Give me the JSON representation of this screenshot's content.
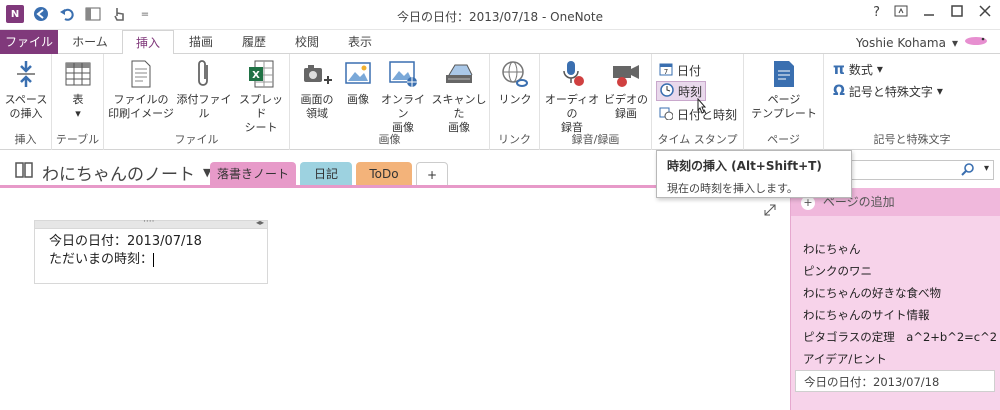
{
  "window": {
    "title": "今日の日付：2013/07/18 - OneNote",
    "help": "?",
    "qat_more": "="
  },
  "tabs": {
    "file": "ファイル",
    "items": [
      "ホーム",
      "挿入",
      "描画",
      "履歴",
      "校閲",
      "表示"
    ]
  },
  "user": {
    "name": "Yoshie Kohama"
  },
  "ribbon": {
    "space": [
      "スペース",
      "の挿入"
    ],
    "table": [
      "表"
    ],
    "printout": [
      "ファイルの",
      "印刷イメージ"
    ],
    "attach": [
      "添付ファイル"
    ],
    "spreadsheet": [
      "スプレッド",
      "シート"
    ],
    "screen": [
      "画面の",
      "領域"
    ],
    "picture": [
      "画像"
    ],
    "online": [
      "オンライン",
      "画像"
    ],
    "scanned": [
      "スキャンした",
      "画像"
    ],
    "link": [
      "リンク"
    ],
    "audio": [
      "オーディオの",
      "録音"
    ],
    "video": [
      "ビデオの",
      "録画"
    ],
    "date": "日付",
    "time": "時刻",
    "datetime": "日付と時刻",
    "template": [
      "ページ",
      "テンプレート"
    ],
    "equation": "数式",
    "symbol": "記号と特殊文字",
    "groups": [
      "挿入",
      "テーブル",
      "ファイル",
      "画像",
      "リンク",
      "録音/録画",
      "タイム スタンプ",
      "ページ",
      "記号と特殊文字"
    ]
  },
  "tooltip": {
    "title": "時刻の挿入 (Alt+Shift+T)",
    "desc": "現在の時刻を挿入します。"
  },
  "notebook": {
    "name": "わにちゃんのノート",
    "sections": [
      "落書きノート",
      "日記",
      "ToDo",
      "+"
    ]
  },
  "note": {
    "line1": "今日の日付：2013/07/18",
    "line2": "ただいまの時刻："
  },
  "pages": {
    "add": "ページの追加",
    "items": [
      "わにちゃん",
      "ピンクのワニ",
      "わにちゃんの好きな食べ物",
      "わにちゃんのサイト情報",
      "ピタゴラスの定理　a^2+b^2=c^2",
      "アイデア/ヒント",
      "今日の日付：2013/07/18"
    ]
  }
}
